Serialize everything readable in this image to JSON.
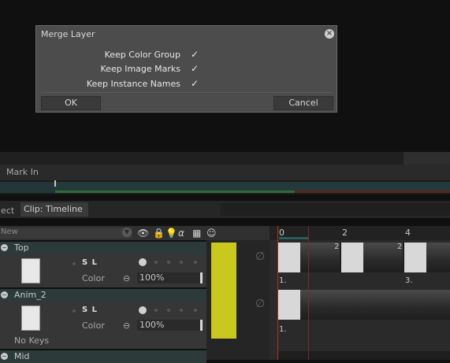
{
  "dialog": {
    "title": "Merge Layer",
    "options": [
      {
        "label": "Keep Color Group",
        "checked": true
      },
      {
        "label": "Keep Image Marks",
        "checked": true
      },
      {
        "label": "Keep Instance Names",
        "checked": true
      }
    ],
    "ok_label": "OK",
    "cancel_label": "Cancel",
    "check_glyph": "✓"
  },
  "timeline": {
    "mark_in_label": "Mark In",
    "tab_project_label": "ject",
    "tab_clip_label": "Clip: Timeline",
    "new_layer_label": "New",
    "frame_ticks": [
      "0",
      "2",
      "4"
    ],
    "layers": [
      {
        "name": "Top",
        "color_label": "Color",
        "opacity": "100%",
        "frames": [
          "1.",
          "3."
        ],
        "cel_marks": [
          "2",
          "2"
        ]
      },
      {
        "name": "Anim_2",
        "color_label": "Color",
        "opacity": "100%",
        "frames": [
          "1."
        ],
        "status": "No Keys"
      },
      {
        "name": "Mid"
      }
    ],
    "sl_label": "S L",
    "header_icons": [
      "eye-icon",
      "lock-icon",
      "light-icon",
      "alpha-icon",
      "grid-icon",
      "face-icon"
    ]
  },
  "colors": {
    "dialog_bg": "#4c4c4c",
    "layer_accent": "#c8c81e",
    "playhead": "#b23030"
  }
}
